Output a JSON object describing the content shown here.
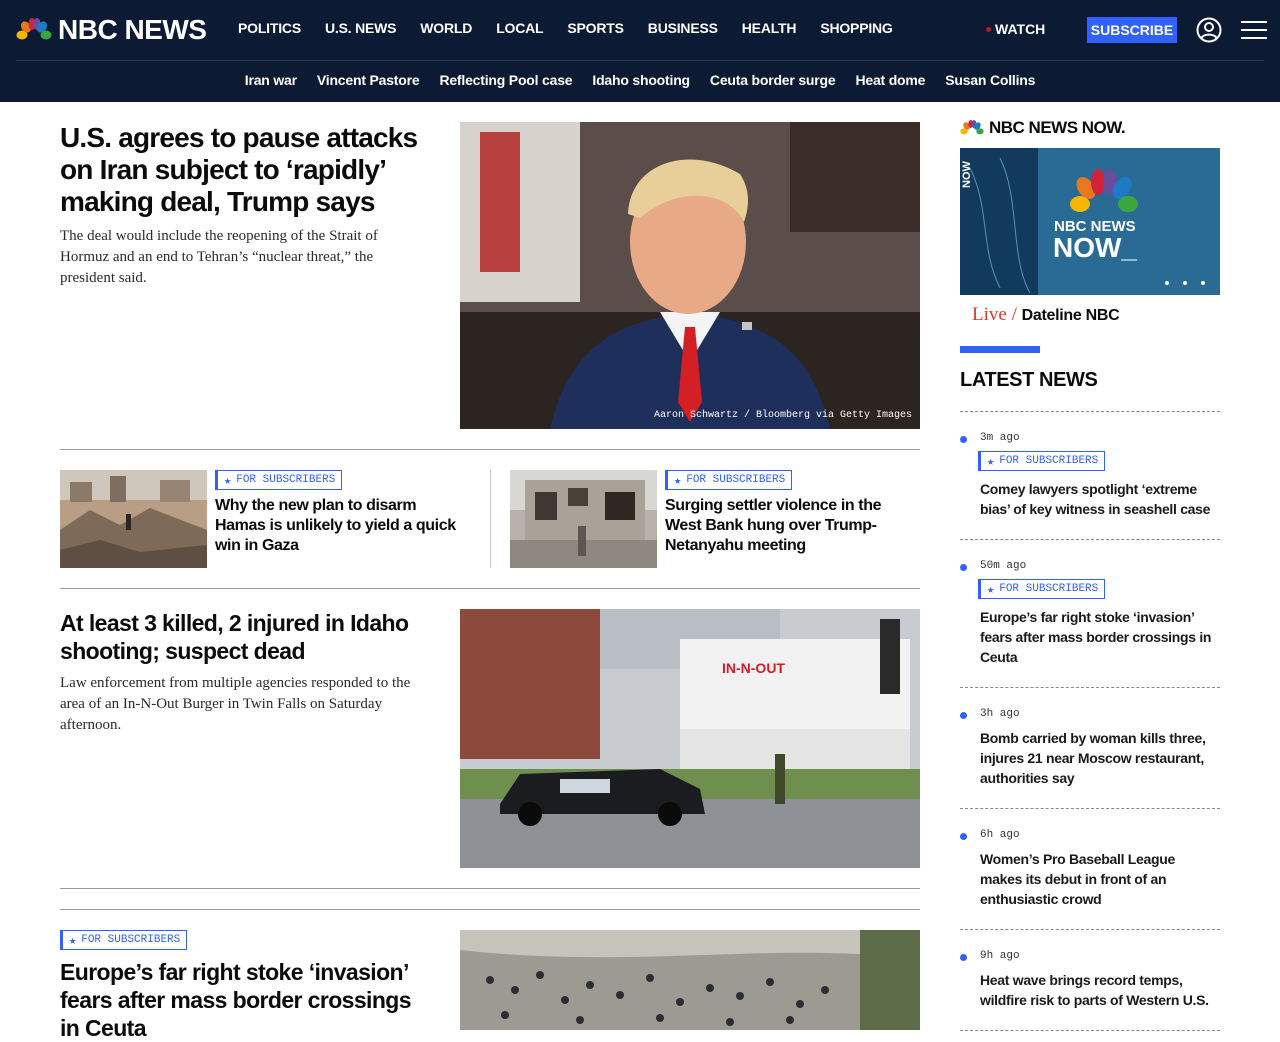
{
  "header": {
    "brand": "NBC NEWS",
    "nav": [
      "POLITICS",
      "U.S. NEWS",
      "WORLD",
      "LOCAL",
      "SPORTS",
      "BUSINESS",
      "HEALTH",
      "SHOPPING"
    ],
    "watch_label": "WATCH",
    "subscribe_label": "SUBSCRIBE",
    "trending": [
      "Iran war",
      "Vincent Pastore",
      "Reflecting Pool case",
      "Idaho shooting",
      "Ceuta border surge",
      "Heat dome",
      "Susan Collins"
    ],
    "accent_color": "#3061ff",
    "bar_color": "#0d1a33"
  },
  "lead": {
    "headline": "U.S. agrees to pause attacks on Iran subject to ‘rapidly’ making deal, Trump says",
    "dek": "The deal would include the reopening of the Strait of Hormuz and an end to Tehran’s “nuclear threat,” the president said.",
    "credit": "Aaron Schwartz / Bloomberg via Getty Images"
  },
  "pair": [
    {
      "badge": "FOR SUBSCRIBERS",
      "headline": "Why the new plan to disarm Hamas is unlikely to yield a quick win in Gaza"
    },
    {
      "badge": "FOR SUBSCRIBERS",
      "headline": "Surging settler violence in the West Bank hung over Trump-Netanyahu meeting"
    }
  ],
  "second": {
    "headline": "At least 3 killed, 2 injured in Idaho shooting; suspect dead",
    "dek": "Law enforcement from multiple agencies responded to the area of an In-N-Out Burger in Twin Falls on Saturday afternoon.",
    "sign_text": "IN-N-OUT"
  },
  "third": {
    "badge": "FOR SUBSCRIBERS",
    "headline": "Europe’s far right stoke ‘invasion’ fears after mass border crossings in Ceuta"
  },
  "rail": {
    "now_brand": "NBC NEWS NOW.",
    "video_logo_top": "NBC NEWS",
    "video_logo_bottom": "NOW_",
    "video_side_text": "NOW",
    "live_label": "Live /",
    "live_show": "Dateline NBC",
    "latest_title": "LATEST NEWS",
    "latest": [
      {
        "time": "3m ago",
        "badge": "FOR SUBSCRIBERS",
        "headline": "Comey lawyers spotlight ‘extreme bias’ of key witness in seashell case"
      },
      {
        "time": "50m ago",
        "badge": "FOR SUBSCRIBERS",
        "headline": "Europe’s far right stoke ‘invasion’ fears after mass border crossings in Ceuta"
      },
      {
        "time": "3h ago",
        "headline": "Bomb carried by woman kills three, injures 21 near Moscow restaurant, authorities say"
      },
      {
        "time": "6h ago",
        "headline": "Women’s Pro Baseball League makes its debut in front of an enthusiastic crowd"
      },
      {
        "time": "9h ago",
        "headline": "Heat wave brings record temps, wildfire risk to parts of Western U.S."
      }
    ]
  }
}
